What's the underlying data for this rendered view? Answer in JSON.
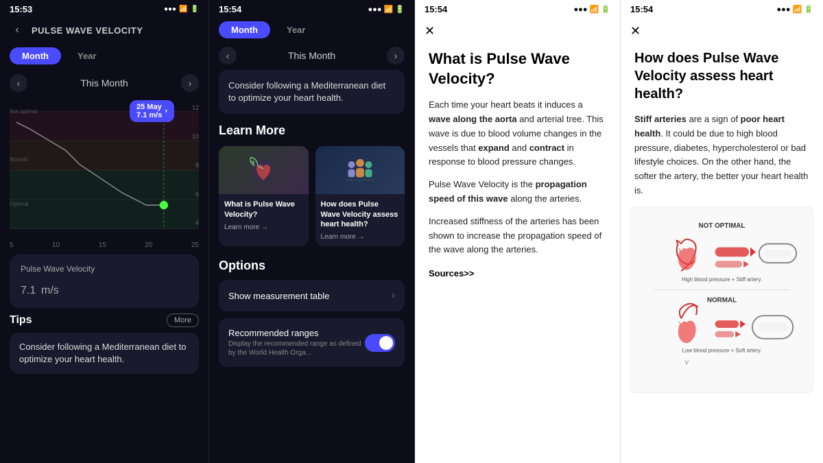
{
  "panel1": {
    "time": "15:53",
    "title": "PULSE WAVE VELOCITY",
    "tab_month": "Month",
    "tab_year": "Year",
    "active_tab": "month",
    "period": "This Month",
    "tooltip_date": "25 May",
    "tooltip_value": "7.1 m/s",
    "y_labels": [
      "12",
      "10",
      "8",
      "6",
      "4"
    ],
    "x_labels": [
      "5",
      "10",
      "15",
      "20",
      "25"
    ],
    "zone_not_optimal": "Not optimal",
    "zone_normal": "Normal",
    "zone_optimal": "Optimal",
    "metric_label": "Pulse Wave Velocity",
    "metric_value": "7.1",
    "metric_unit": "m/s",
    "tips_title": "Tips",
    "more_btn": "More",
    "tip_text": "Consider following a Mediterranean diet to optimize your heart health."
  },
  "panel2": {
    "time": "15:54",
    "tab_month": "Month",
    "tab_year": "Year",
    "period": "This Month",
    "tip_text": "Consider following a Mediterranean diet to optimize your heart health.",
    "learn_more_title": "Learn More",
    "card1_title": "What is Pulse Wave Velocity?",
    "card1_link": "Learn more →",
    "card2_title": "How does Pulse Wave Velocity assess heart health?",
    "card2_link": "Learn more →",
    "options_title": "Options",
    "show_table_label": "Show measurement table",
    "recommended_ranges_title": "Recommended ranges",
    "recommended_ranges_sub": "Display the recommended range as defined by the World Health Orga..."
  },
  "panel3": {
    "time": "15:54",
    "article_title": "What is Pulse Wave Velocity?",
    "para1_text": "Each time your heart beats it induces a ",
    "para1_bold1": "wave along the aorta",
    "para1_cont": " and arterial tree. This wave is due to blood volume changes in the vessels that ",
    "para1_bold2": "expand",
    "para1_cont2": " and ",
    "para1_bold3": "contract",
    "para1_cont3": " in response to blood pressure changes.",
    "para2_text": "Pulse Wave Velocity is the ",
    "para2_bold": "propagation speed of this wave",
    "para2_cont": " along the arteries.",
    "para3": "Increased stiffness of the arteries has been shown to increase the propagation speed of the wave along the arteries.",
    "sources": "Sources>>"
  },
  "panel4": {
    "time": "15:54",
    "article_title": "How does Pulse Wave Velocity assess heart health?",
    "para1_text": "",
    "para1_bold": "Stiff arteries",
    "para1_cont": " are a sign of ",
    "para1_bold2": "poor heart health",
    "para1_cont2": ". It could be due to high blood pressure, diabetes, hypercholesterol or bad lifestyle choices. On the other hand, the softer the artery, the better your heart health is.",
    "label_not_optimal": "NOT OPTIMAL",
    "label_normal": "NORMAL",
    "label_high_bp": "High blood pressure + Stiff artery.",
    "label_low_bp": "Low blood pressure + Soft artery."
  }
}
